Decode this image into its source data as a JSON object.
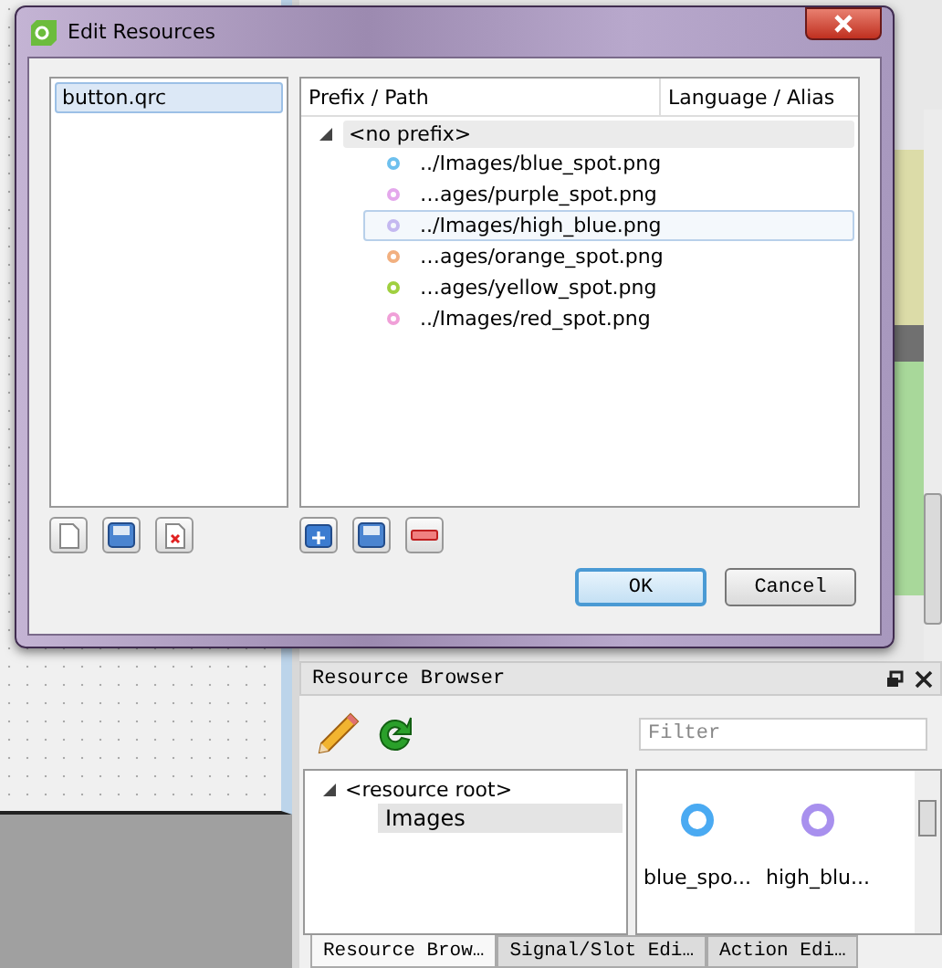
{
  "dialog": {
    "title": "Edit Resources",
    "files": [
      {
        "label": "button.qrc",
        "selected": true
      }
    ],
    "columns": [
      "Prefix / Path",
      "Language / Alias"
    ],
    "prefixes": [
      {
        "label": "<no prefix>",
        "expanded": true,
        "children": [
          {
            "label": "../Images/blue_spot.png",
            "color": "#6ec0ee",
            "selected": false
          },
          {
            "label": "…ages/purple_spot.png",
            "color": "#e4a8ec",
            "selected": false
          },
          {
            "label": "../Images/high_blue.png",
            "color": "#c4b8f0",
            "selected": true
          },
          {
            "label": "…ages/orange_spot.png",
            "color": "#f2b080",
            "selected": false
          },
          {
            "label": "…ages/yellow_spot.png",
            "color": "#a0d040",
            "selected": false
          },
          {
            "label": "../Images/red_spot.png",
            "color": "#f0a0d8",
            "selected": false
          }
        ]
      }
    ],
    "buttons": [
      {
        "label": "OK",
        "default": true
      },
      {
        "label": "Cancel",
        "default": false
      }
    ]
  },
  "resource_browser": {
    "title": "Resource Browser",
    "filter": {
      "placeholder": "Filter"
    },
    "tree": [
      {
        "label": "<resource root>",
        "expanded": true,
        "children": [
          {
            "label": "Images",
            "selected": true
          }
        ]
      }
    ],
    "images": [
      {
        "label": "blue_spo...",
        "color": "#4aaaf2"
      },
      {
        "label": "high_blu...",
        "color": "#a890ee"
      }
    ]
  },
  "tabs": [
    {
      "label": "Resource Brow…",
      "selected": true
    },
    {
      "label": "Signal/Slot Edi…",
      "selected": false
    },
    {
      "label": "Action Edi…",
      "selected": false
    }
  ]
}
